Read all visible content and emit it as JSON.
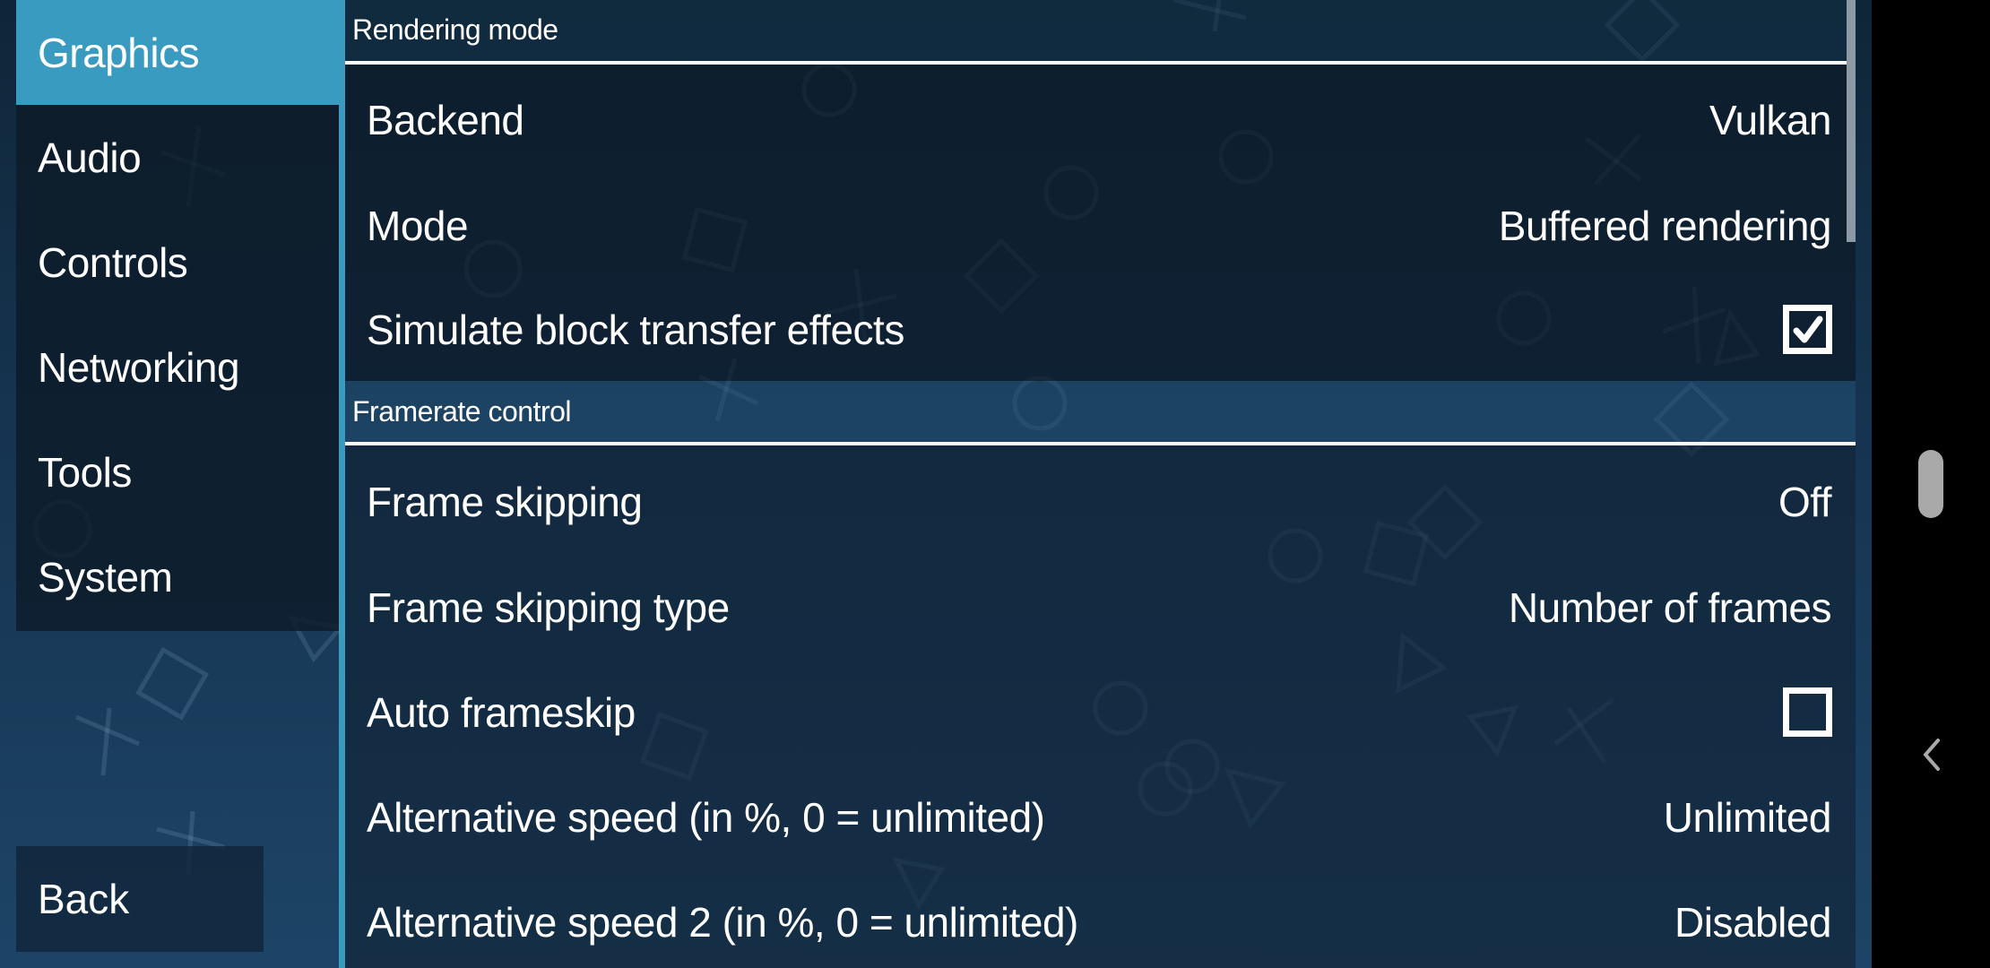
{
  "sidebar": {
    "items": [
      {
        "label": "Graphics",
        "active": true
      },
      {
        "label": "Audio",
        "active": false
      },
      {
        "label": "Controls",
        "active": false
      },
      {
        "label": "Networking",
        "active": false
      },
      {
        "label": "Tools",
        "active": false
      },
      {
        "label": "System",
        "active": false
      }
    ],
    "back_label": "Back"
  },
  "groups": [
    {
      "header": "Rendering mode",
      "rows": [
        {
          "label": "Backend",
          "value": "Vulkan",
          "type": "choice"
        },
        {
          "label": "Mode",
          "value": "Buffered rendering",
          "type": "choice"
        },
        {
          "label": "Simulate block transfer effects",
          "checked": true,
          "type": "checkbox"
        }
      ]
    },
    {
      "header": "Framerate control",
      "rows": [
        {
          "label": "Frame skipping",
          "value": "Off",
          "type": "choice"
        },
        {
          "label": "Frame skipping type",
          "value": "Number of frames",
          "type": "choice"
        },
        {
          "label": "Auto frameskip",
          "checked": false,
          "type": "checkbox"
        },
        {
          "label": "Alternative speed (in %, 0 = unlimited)",
          "value": "Unlimited",
          "type": "choice"
        },
        {
          "label": "Alternative speed 2 (in %, 0 = unlimited)",
          "value": "Disabled",
          "type": "choice"
        }
      ]
    }
  ],
  "colors": {
    "accent": "#3a9bc1",
    "text": "#ffffff",
    "scrollbar": "#8b9aa4"
  },
  "navbar": {
    "home_icon": "home-pill-icon",
    "back_icon": "back-chevron-icon"
  }
}
